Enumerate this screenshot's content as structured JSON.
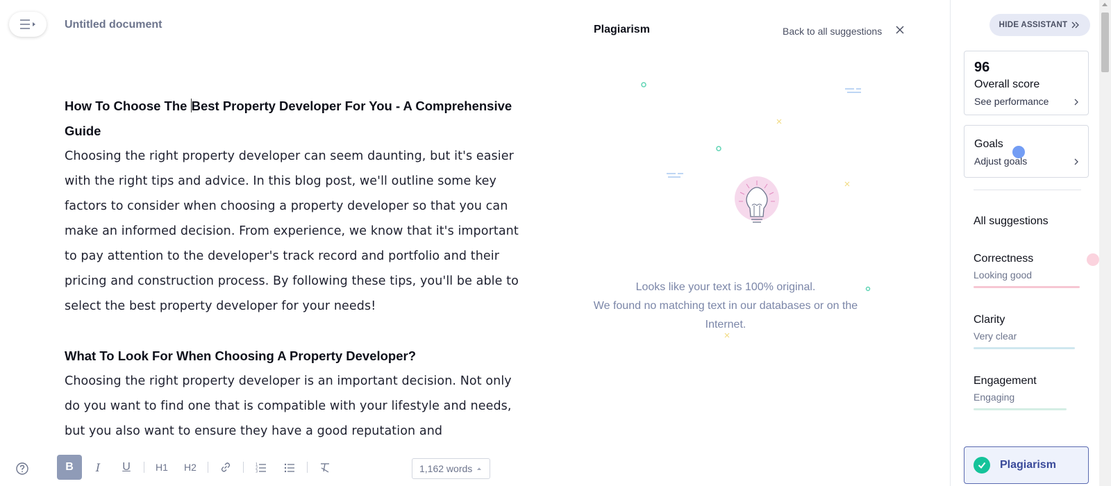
{
  "header": {
    "doc_title": "Untitled document"
  },
  "editor": {
    "heading1_pre": "How To Choose The ",
    "heading1_post": "Best Property Developer For You - A Comprehensive Guide",
    "para1": "Choosing the right property developer can seem daunting, but it's easier with the right tips and advice. In this blog post, we'll outline some key factors to consider when choosing a property developer so that you can make an informed decision. From experience, we know that it's important to pay attention to the developer's track record and portfolio and their pricing and construction process. By following these tips, you'll be able to select the best property developer for your needs!",
    "heading2": "What To Look For When Choosing A Property Developer?",
    "para2": "Choosing the right property developer is an important decision. Not only do you want to find one that is compatible with your lifestyle and needs, but you also want to ensure they have a good reputation and"
  },
  "plagiarism_panel": {
    "title": "Plagiarism",
    "back_link": "Back to all suggestions",
    "message_line1": "Looks like your text is 100% original.",
    "message_line2": "We found no matching text in our databases or on the Internet."
  },
  "toolbar": {
    "bold": "B",
    "italic": "I",
    "underline": "U",
    "h1": "H1",
    "h2": "H2",
    "word_count": "1,162 words",
    "icons": [
      "help-icon",
      "link-icon",
      "ordered-list-icon",
      "bullet-list-icon",
      "clear-format-icon"
    ]
  },
  "sidebar": {
    "hide_button": "HIDE ASSISTANT",
    "score_value": "96",
    "score_label": "Overall score",
    "score_link": "See performance",
    "goals_label": "Goals",
    "goals_link": "Adjust goals",
    "all_suggestions": "All suggestions",
    "categories": [
      {
        "name": "Correctness",
        "status": "Looking good",
        "color": "#f6c7d3"
      },
      {
        "name": "Clarity",
        "status": "Very clear",
        "color": "#cfe7ef"
      },
      {
        "name": "Engagement",
        "status": "Engaging",
        "color": "#d5eee5"
      }
    ],
    "plagiarism_button": "Plagiarism"
  },
  "colors": {
    "accent": "#15c39a",
    "bold_active": "#8f9bb7",
    "plagiarism_border": "#5a6ab0"
  }
}
